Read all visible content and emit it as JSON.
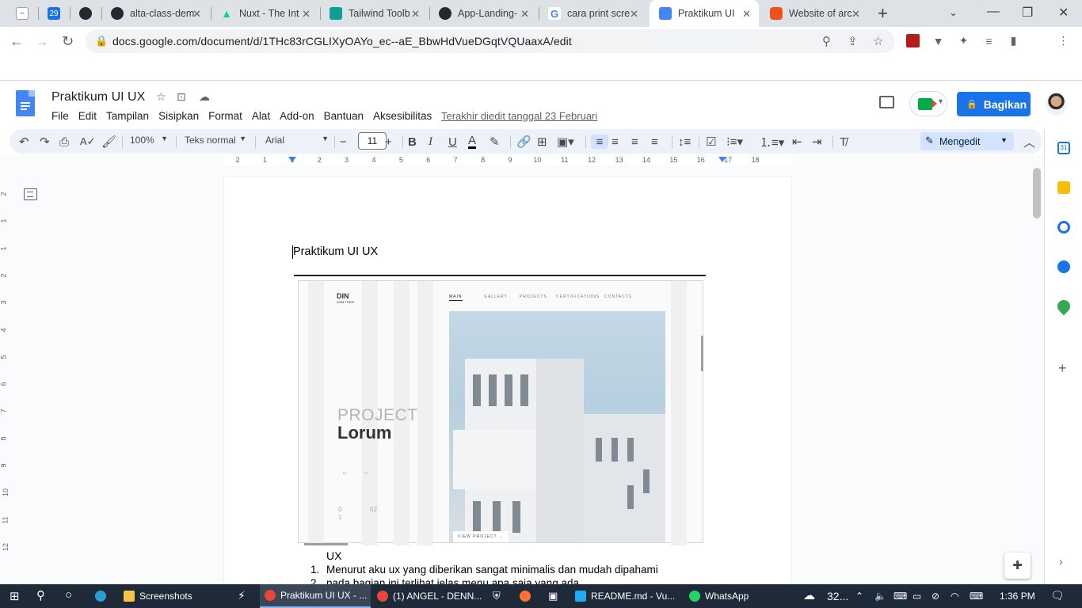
{
  "browser": {
    "tabs": [
      {
        "title": "",
        "fav_color": "#3c4043",
        "fav_text": "~"
      },
      {
        "title": "",
        "fav_color": "#1a73e8",
        "fav_text": "29"
      },
      {
        "title": "",
        "fav_color": "#24292f",
        "fav_text": ""
      },
      {
        "title": "alta-class-dem",
        "fav_color": "#24292f",
        "fav_text": ""
      },
      {
        "title": "Nuxt - The Int",
        "fav_color": "#00dc82",
        "fav_text": ""
      },
      {
        "title": "Tailwind Toolb",
        "fav_color": "#0f9d9a",
        "fav_text": ""
      },
      {
        "title": "App-Landing-",
        "fav_color": "#24292f",
        "fav_text": ""
      },
      {
        "title": "cara print scre",
        "fav_color": "#4285f4",
        "fav_text": "G"
      },
      {
        "title": "Praktikum UI",
        "fav_color": "#4285f4",
        "fav_text": ""
      },
      {
        "title": "Website of arc",
        "fav_color": "#f24e1e",
        "fav_text": ""
      }
    ],
    "url": "docs.google.com/document/d/1THc83rCGLIXyOAYo_ec--aE_BbwHdVueDGqtVQUaaxA/edit"
  },
  "docs": {
    "title": "Praktikum UI UX",
    "menu": [
      "File",
      "Edit",
      "Tampilan",
      "Sisipkan",
      "Format",
      "Alat",
      "Add-on",
      "Bantuan",
      "Aksesibilitas"
    ],
    "last_edit": "Terakhir diedit tanggal 23 Februari",
    "share_label": "Bagikan",
    "toolbar": {
      "zoom": "100%",
      "style": "Teks normal",
      "font": "Arial",
      "font_size": "11",
      "mode": "Mengedit"
    },
    "ruler_h": [
      "2",
      "1",
      "1",
      "2",
      "3",
      "4",
      "5",
      "6",
      "7",
      "8",
      "9",
      "10",
      "11",
      "12",
      "13",
      "14",
      "15",
      "16",
      "17",
      "18"
    ],
    "ruler_v": [
      "2",
      "1",
      "1",
      "2",
      "3",
      "4",
      "5",
      "6",
      "7",
      "8",
      "9",
      "10",
      "11",
      "12"
    ],
    "content": {
      "heading": "Praktikum UI UX",
      "embed": {
        "brand": "DIN",
        "brand_sub": "DOM TREIS",
        "nav": [
          "MAIN",
          "GALLERY",
          "PROJECTS",
          "CERTIFICATIONS",
          "CONTACTS"
        ],
        "project_label": "PROJECT",
        "project_name": "Lorum",
        "arrow_prev": "←",
        "arrow_next": "→",
        "counter_current": "0\n1",
        "counter_total": "02",
        "view_project": "VIEW PROJECT  →"
      },
      "after_image": "UX",
      "list": [
        {
          "num": "1.",
          "text": "Menurut aku ux yang diberikan sangat minimalis dan mudah dipahami"
        },
        {
          "num": "2.",
          "text": "pada bagian ini terlihat jelas menu apa saja yang ada"
        }
      ]
    }
  },
  "taskbar": {
    "items": [
      {
        "label": "Screenshots",
        "color": "#f6c344"
      },
      {
        "label": "Praktikum UI UX - ...",
        "color": "#e8453c"
      },
      {
        "label": "(1) ANGEL - DENN...",
        "color": "#e8453c"
      },
      {
        "label": "README.md - Vu...",
        "color": "#23a9f2"
      },
      {
        "label": "WhatsApp",
        "color": "#25d366"
      }
    ],
    "weather": "32...",
    "time": "1:36 PM"
  }
}
